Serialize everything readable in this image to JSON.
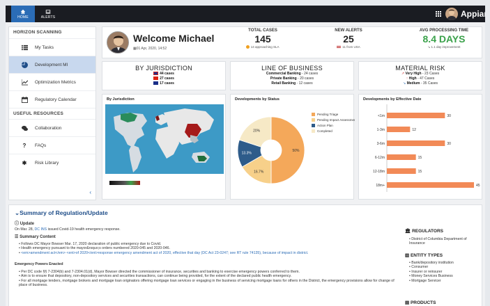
{
  "nav": {
    "tabs": [
      {
        "label": "HOME"
      },
      {
        "label": "ALERTS"
      }
    ],
    "brand": "Appian"
  },
  "sidebar": {
    "section1": "HORIZON SCANNING",
    "items1": [
      {
        "label": "My Tasks"
      },
      {
        "label": "Development MI"
      },
      {
        "label": "Optimization Metrics"
      },
      {
        "label": "Regulatory Calendar"
      }
    ],
    "section2": "USEFUL RESOURCES",
    "items2": [
      {
        "label": "Collaboration"
      },
      {
        "label": "FAQs"
      },
      {
        "label": "Risk Library"
      }
    ]
  },
  "welcome": {
    "title": "Welcome Michael",
    "date": "01 Apr, 2020, 14:52"
  },
  "kpis": [
    {
      "label": "TOTAL CASES",
      "value": "145",
      "sub": "14 approaching SLA"
    },
    {
      "label": "NEW ALERTS",
      "value": "25",
      "sub": "11 from USA"
    },
    {
      "label": "AVG PROCESSING TIME",
      "value": "8.4 DAYS",
      "sub": "1.1 day improvement"
    }
  ],
  "jurisdiction": {
    "title": "BY JURISDICTION",
    "rows": [
      {
        "text": "44 cases"
      },
      {
        "text": "27 cases"
      },
      {
        "text": "17 cases"
      }
    ]
  },
  "lob": {
    "title": "LINE OF BUSINESS",
    "rows": [
      {
        "name": "Commercial Banking",
        "text": " - 24 cases"
      },
      {
        "name": "Private Banking",
        "text": " - 20 cases"
      },
      {
        "name": "Retail Banking",
        "text": " - 12 cases"
      }
    ]
  },
  "risk": {
    "title": "MATERIAL RISK",
    "rows": [
      {
        "name": "Very High",
        "text": " - 23 Cases"
      },
      {
        "name": "High",
        "text": " - 47 Cases"
      },
      {
        "name": "Medium",
        "text": " - 35 Cases"
      }
    ]
  },
  "charts_titles": {
    "map": "By Jurisdiction",
    "status": "Developments by Status",
    "effective": "Developments by Effective Date"
  },
  "chart_data": [
    {
      "type": "pie",
      "title": "Developments by Status",
      "categories": [
        "Pending Triage",
        "Pending Impact Assessment",
        "Action Plan",
        "Completed"
      ],
      "values": [
        50,
        16.7,
        13.3,
        20
      ],
      "labels": [
        "50%",
        "16.7%",
        "13.3%",
        "20%"
      ],
      "colors": [
        "#f4a85a",
        "#f7d08a",
        "#2e5c8a",
        "#f6e9c6"
      ],
      "legend": "right"
    },
    {
      "type": "bar",
      "title": "Developments by Effective Date",
      "categories": [
        "<1m",
        "1-3m",
        "3-6m",
        "6-12m",
        "12-18m",
        "18m+"
      ],
      "values": [
        30,
        12,
        30,
        15,
        15,
        45
      ],
      "orientation": "horizontal",
      "color": "#f28a57"
    }
  ],
  "summary": {
    "title": "Summary of Regulation/Update",
    "update_label": "Update",
    "update_pre": "On Mar. 28, ",
    "update_link": "DC INS",
    "update_post": " issued Covid-19 health emergency response.",
    "summary_label": "Summary Content",
    "bullets": [
      "Follows DC Mayor Bowser Mar. 17, 2020 declaration of public emergency due to Covid.",
      "Health emergency pursuant to the mayor&rsquo;s orders numbered 2020-045 and 2020-046.",
      "<em>amendment act</em> <ent>of 2020</ent>response emergency amendment act of 2020, effective that day (DC Act 23-0247; see RT rule 74135), because of impact in district."
    ],
    "powers_label": "Emergency Powers Enacted",
    "powers": [
      "Per DC code §§ 7-2304(b) and 7-2304.01(d), Mayor Bowser directed the commissioner of insurance, securities and banking to exercise emergency powers conferred to them.",
      "Aim is to ensure that depository, non-depository services and securities transactions, can continue being provided, for the extent of the declared public health emergency.",
      "For all mortgage lenders, mortgage brokers and mortgage loan originators offering mortgage loan services or engaging in the business of servicing mortgage loans for others in the District, the emergency provisions allow for change of place of business."
    ]
  },
  "right": {
    "regulators_label": "REGULATORS",
    "regulators": [
      "District of Columbia Department of Insurance"
    ],
    "entity_label": "ENTITY TYPES",
    "entities": [
      "Bank/depository institution",
      "Consumer",
      "Insurer or reinsurer",
      "Money Services Business",
      "Mortgage Servicer"
    ],
    "products_label": "PRODUCTS"
  },
  "colors": {
    "accent": "#2b6cb6",
    "green": "#3aa14a",
    "topbar": "#1a1c22"
  }
}
